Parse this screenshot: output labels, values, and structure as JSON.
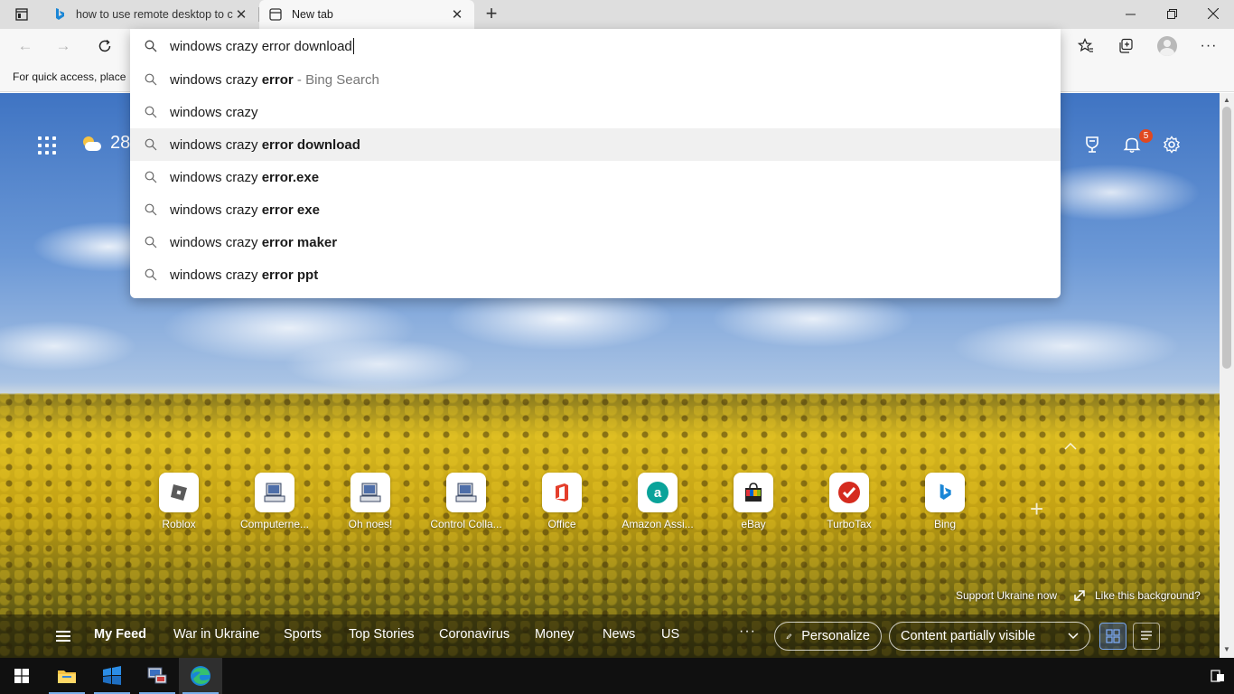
{
  "tabs": [
    {
      "title": "how to use remote desktop to co",
      "active": false
    },
    {
      "title": "New tab",
      "active": true
    }
  ],
  "favorites_bar": {
    "text": "For quick access, place y"
  },
  "address_bar": {
    "value": "windows crazy error download",
    "suggestions": [
      {
        "plain": "windows crazy ",
        "bold": "error",
        "hint": " - Bing Search"
      },
      {
        "plain": "windows crazy",
        "bold": "",
        "hint": ""
      },
      {
        "plain": "windows crazy ",
        "bold": "error download",
        "hint": "",
        "selected": true
      },
      {
        "plain": "windows crazy ",
        "bold": "error.exe",
        "hint": ""
      },
      {
        "plain": "windows crazy ",
        "bold": "error exe",
        "hint": ""
      },
      {
        "plain": "windows crazy ",
        "bold": "error maker",
        "hint": ""
      },
      {
        "plain": "windows crazy ",
        "bold": "error ppt",
        "hint": ""
      }
    ]
  },
  "weather": {
    "temp": "28"
  },
  "notifications": {
    "count": "5"
  },
  "quick_links": [
    {
      "label": "Roblox",
      "icon": "roblox-icon"
    },
    {
      "label": "Computerne...",
      "icon": "computer-icon"
    },
    {
      "label": "Oh noes!",
      "icon": "computer-icon"
    },
    {
      "label": "Control Colla...",
      "icon": "computer-icon"
    },
    {
      "label": "Office",
      "icon": "office-icon"
    },
    {
      "label": "Amazon Assi...",
      "icon": "amazon-icon"
    },
    {
      "label": "eBay",
      "icon": "ebay-icon"
    },
    {
      "label": "TurboTax",
      "icon": "turbotax-icon"
    },
    {
      "label": "Bing",
      "icon": "bing-icon"
    }
  ],
  "background_links": {
    "support": "Support Ukraine now",
    "like": "Like this background?"
  },
  "feed_nav": {
    "items": [
      "My Feed",
      "War in Ukraine",
      "Sports",
      "Top Stories",
      "Coronavirus",
      "Money",
      "News",
      "US"
    ],
    "more": "···",
    "personalize": "Personalize",
    "content_visibility": "Content partially visible"
  },
  "colors": {
    "accent": "#0078d4",
    "badge": "#e0481f",
    "edge_blue": "#1a86d6",
    "edge_green": "#35c06f"
  }
}
